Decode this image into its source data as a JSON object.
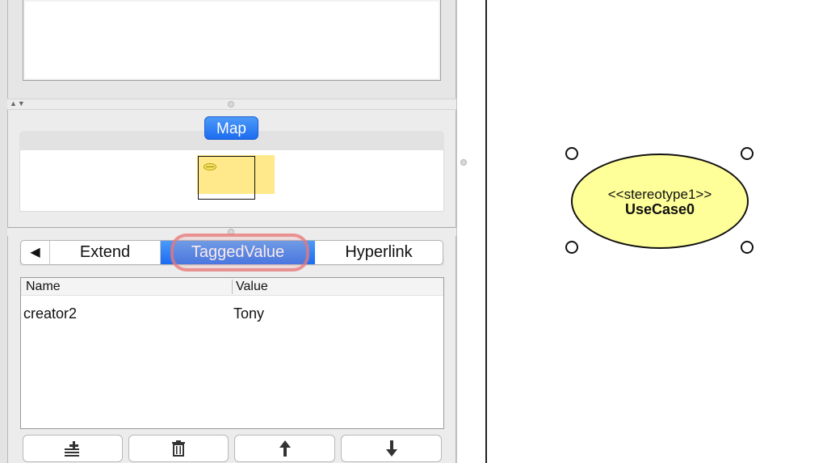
{
  "map_panel": {
    "button_label": "Map"
  },
  "tabs": {
    "scroll_left_glyph": "◀",
    "items": [
      {
        "label": "Extend",
        "selected": false
      },
      {
        "label": "TaggedValue",
        "selected": true
      },
      {
        "label": "Hyperlink",
        "selected": false
      }
    ]
  },
  "tagged_values_table": {
    "columns": [
      "Name",
      "Value"
    ],
    "rows": [
      {
        "name": "creator2",
        "value": "Tony"
      }
    ]
  },
  "toolbar": {
    "buttons": [
      {
        "icon": "add-row-icon"
      },
      {
        "icon": "trash-icon"
      },
      {
        "icon": "arrow-up-icon"
      },
      {
        "icon": "arrow-down-icon"
      }
    ]
  },
  "splitter": {
    "arrows": "▲▼"
  },
  "diagram": {
    "usecase": {
      "stereotype": "<<stereotype1>>",
      "name": "UseCase0",
      "fill_color": "#ffff99"
    }
  },
  "colors": {
    "accent": "#2a7cf4",
    "highlight_ring": "#e77878",
    "panel_bg": "#ececec"
  }
}
